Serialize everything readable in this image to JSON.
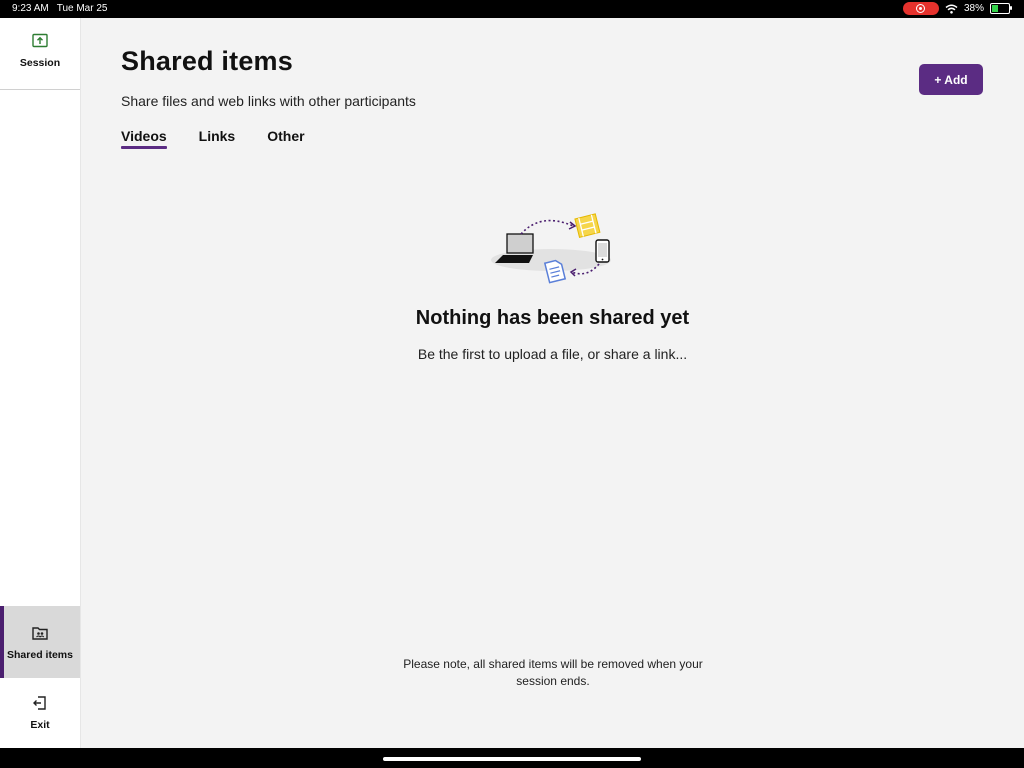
{
  "status_bar": {
    "time": "9:23 AM",
    "date": "Tue Mar 25",
    "battery": "38%",
    "battery_level": 0.38,
    "icons": [
      "screen-recording-icon",
      "wifi-icon",
      "battery-charging-icon"
    ]
  },
  "sidebar": {
    "session": {
      "label": "Session",
      "icon": "upload-icon"
    },
    "shared_items": {
      "label": "Shared items",
      "icon": "shared-folder-icon",
      "active": true
    },
    "exit": {
      "label": "Exit",
      "icon": "exit-icon"
    }
  },
  "main": {
    "title": "Shared items",
    "subtitle": "Share files and web links with other participants",
    "add_button": "+ Add",
    "tabs": [
      {
        "label": "Videos",
        "active": true
      },
      {
        "label": "Links",
        "active": false
      },
      {
        "label": "Other",
        "active": false
      }
    ],
    "empty_state": {
      "title": "Nothing has been shared yet",
      "message": "Be the first to upload a file, or share a link..."
    },
    "note": "Please note, all shared items will be removed when your session ends."
  },
  "colors": {
    "accent": "#5b2c83",
    "sidebar_active": "#d9d9d9",
    "background": "#f3f3f3"
  }
}
